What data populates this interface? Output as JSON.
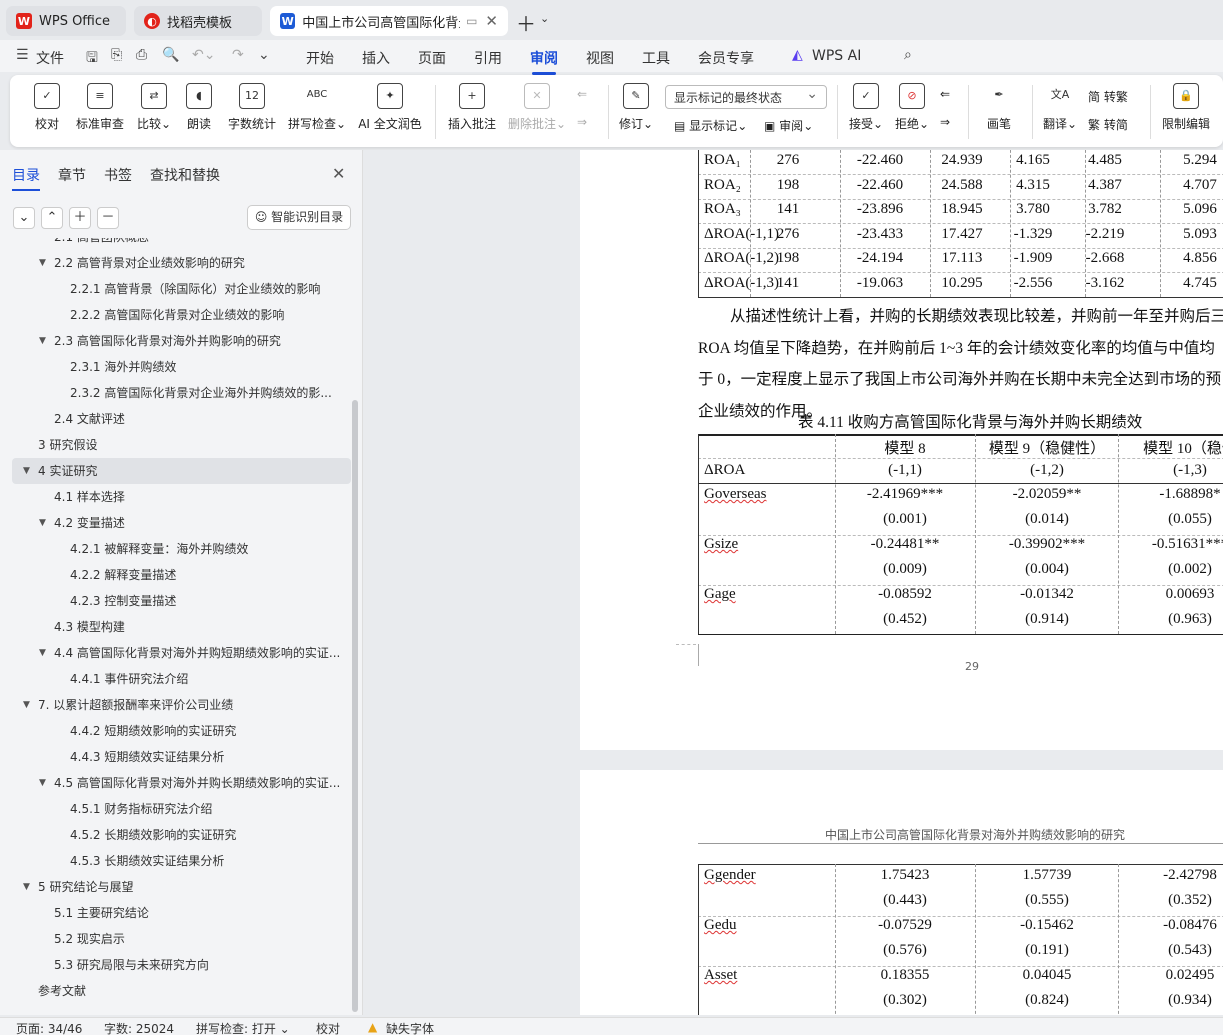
{
  "tabs": [
    {
      "label": "WPS Office",
      "icon": "wps-logo-icon"
    },
    {
      "label": "找稻壳模板",
      "icon": "docer-logo-icon"
    },
    {
      "label": "中国上市公司高管国际化背景",
      "icon": "word-doc-icon",
      "active": true
    }
  ],
  "menu": {
    "file": "文件",
    "items": [
      "开始",
      "插入",
      "页面",
      "引用",
      "审阅",
      "视图",
      "工具",
      "会员专享"
    ],
    "active": "审阅",
    "ai": "WPS AI"
  },
  "ribbon": {
    "buttons": [
      "校对",
      "标准审查",
      "比较",
      "朗读",
      "字数统计",
      "拼写检查",
      "AI 全文润色",
      "插入批注",
      "删除批注",
      "修订",
      "显示标记",
      "审阅",
      "接受",
      "拒绝",
      "画笔",
      "翻译",
      "转繁",
      "转简",
      "限制编辑"
    ],
    "review_mode": "显示标记的最终状态",
    "icon_text": {
      "wordcount": "12",
      "spell": "ABC",
      "trad": "简",
      "simp": "繁"
    }
  },
  "panel": {
    "tabs": [
      "目录",
      "章节",
      "书签",
      "查找和替换"
    ],
    "smart_btn": "智能识别目录",
    "toc": [
      {
        "t": "2.1 高管团队概念",
        "l": 2
      },
      {
        "t": "2.2 高管背景对企业绩效影响的研究",
        "l": 2,
        "c": 1
      },
      {
        "t": "2.2.1 高管背景（除国际化）对企业绩效的影响",
        "l": 3
      },
      {
        "t": "2.2.2 高管国际化背景对企业绩效的影响",
        "l": 3
      },
      {
        "t": "2.3 高管国际化背景对海外并购影响的研究",
        "l": 2,
        "c": 1
      },
      {
        "t": "2.3.1 海外并购绩效",
        "l": 3
      },
      {
        "t": "2.3.2 高管国际化背景对企业海外并购绩效的影...",
        "l": 3
      },
      {
        "t": "2.4 文献评述",
        "l": 2
      },
      {
        "t": "3 研究假设",
        "l": 1
      },
      {
        "t": "4 实证研究",
        "l": 1,
        "c": 1,
        "sel": 1
      },
      {
        "t": "4.1 样本选择",
        "l": 2
      },
      {
        "t": "4.2 变量描述",
        "l": 2,
        "c": 1
      },
      {
        "t": "4.2.1 被解释变量：海外并购绩效",
        "l": 3
      },
      {
        "t": "4.2.2 解释变量描述",
        "l": 3
      },
      {
        "t": "4.2.3 控制变量描述",
        "l": 3
      },
      {
        "t": "4.3 模型构建",
        "l": 2
      },
      {
        "t": "4.4 高管国际化背景对海外并购短期绩效影响的实证...",
        "l": 2,
        "c": 1
      },
      {
        "t": "4.4.1 事件研究法介绍",
        "l": 3
      },
      {
        "t": "7. 以累计超额报酬率来评价公司业绩",
        "l": 1,
        "c": 1
      },
      {
        "t": "4.4.2 短期绩效影响的实证研究",
        "l": 3
      },
      {
        "t": "4.4.3 短期绩效实证结果分析",
        "l": 3
      },
      {
        "t": "4.5 高管国际化背景对海外并购长期绩效影响的实证...",
        "l": 2,
        "c": 1
      },
      {
        "t": "4.5.1 财务指标研究法介绍",
        "l": 3
      },
      {
        "t": "4.5.2 长期绩效影响的实证研究",
        "l": 3
      },
      {
        "t": "4.5.3 长期绩效实证结果分析",
        "l": 3
      },
      {
        "t": "5 研究结论与展望",
        "l": 1,
        "c": 1
      },
      {
        "t": "5.1 主要研究结论",
        "l": 2
      },
      {
        "t": "5.2 现实启示",
        "l": 2
      },
      {
        "t": "5.3 研究局限与未来研究方向",
        "l": 2
      },
      {
        "t": "参考文献",
        "l": 1
      }
    ]
  },
  "page1": {
    "desc_rows": [
      [
        "ROA₁",
        "276",
        "-22.460",
        "24.939",
        "4.165",
        "4.485",
        "5.294"
      ],
      [
        "ROA₂",
        "198",
        "-22.460",
        "24.588",
        "4.315",
        "4.387",
        "4.707"
      ],
      [
        "ROA₃",
        "141",
        "-23.896",
        "18.945",
        "3.780",
        "3.782",
        "5.096"
      ],
      [
        "ΔROA(-1,1)",
        "276",
        "-23.433",
        "17.427",
        "-1.329",
        "-2.219",
        "5.093"
      ],
      [
        "ΔROA(-1,2)",
        "198",
        "-24.194",
        "17.113",
        "-1.909",
        "-2.668",
        "4.856"
      ],
      [
        "ΔROA(-1,3)",
        "141",
        "-19.063",
        "10.295",
        "-2.556",
        "-3.162",
        "4.745"
      ]
    ],
    "paragraph": [
      "从描述性统计上看，并购的长期绩效表现比较差，并购前一年至并购后三",
      "ROA 均值呈下降趋势，在并购前后 1~3 年的会计绩效变化率的均值与中值均",
      "于 0，一定程度上显示了我国上市公司海外并购在长期中未完全达到市场的预",
      "企业绩效的作用。"
    ],
    "table_title": "表 4.11 收购方高管国际化背景与海外并购长期绩效",
    "headers": [
      "模型 8",
      "模型 9（稳健性）",
      "模型 10（稳健"
    ],
    "dep_row": [
      "ΔROA",
      "(-1,1)",
      "(-1,2)",
      "(-1,3)"
    ],
    "rows": [
      [
        "Goverseas",
        "-2.41969***",
        "-2.02059**",
        "-1.68898*"
      ],
      [
        "",
        "(0.001)",
        "(0.014)",
        "(0.055)"
      ],
      [
        "Gsize",
        "-0.24481**",
        "-0.39902***",
        "-0.51631***"
      ],
      [
        "",
        "(0.009)",
        "(0.004)",
        "(0.002)"
      ],
      [
        "Gage",
        "-0.08592",
        "-0.01342",
        "0.00693"
      ],
      [
        "",
        "(0.452)",
        "(0.914)",
        "(0.963)"
      ]
    ],
    "page_number": "29"
  },
  "page2": {
    "header": "中国上市公司高管国际化背景对海外并购绩效影响的研究",
    "rows": [
      [
        "Ggender",
        "1.75423",
        "1.57739",
        "-2.42798"
      ],
      [
        "",
        "(0.443)",
        "(0.555)",
        "(0.352)"
      ],
      [
        "Gedu",
        "-0.07529",
        "-0.15462",
        "-0.08476"
      ],
      [
        "",
        "(0.576)",
        "(0.191)",
        "(0.543)"
      ],
      [
        "Asset",
        "0.18355",
        "0.04045",
        "0.02495"
      ],
      [
        "",
        "(0.302)",
        "(0.824)",
        "(0.934)"
      ]
    ]
  },
  "status": {
    "page": "页面: 34/46",
    "words": "字数: 25024",
    "spell": "拼写检查: 打开",
    "proof": "校对",
    "missing_font": "缺失字体"
  },
  "colors": {
    "accent": "#1d4fd8",
    "wps_red": "#e2231a",
    "doc_blue": "#1d5bd6",
    "warning": "#e8a317"
  }
}
